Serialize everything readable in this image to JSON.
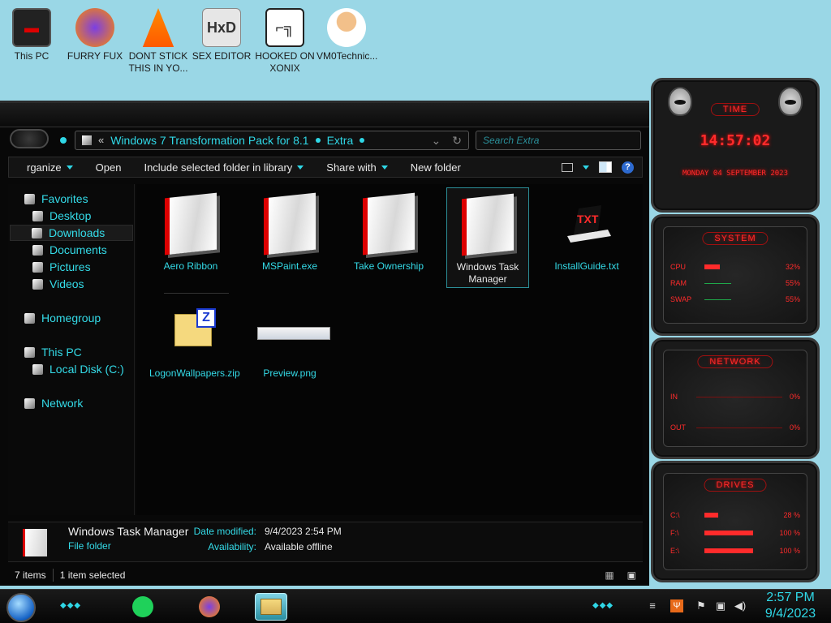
{
  "desktop": {
    "icons": [
      {
        "label": "This PC"
      },
      {
        "label": "FURRY FUX"
      },
      {
        "label": "DONT STICK THIS IN YO..."
      },
      {
        "label": "SEX EDITOR"
      },
      {
        "label": "HOOKED ON XONIX"
      },
      {
        "label": "VM0Technic..."
      }
    ]
  },
  "explorer": {
    "address": {
      "prefix": "«",
      "crumbs": [
        "Windows 7 Transformation Pack for 8.1",
        "Extra"
      ]
    },
    "search_placeholder": "Search Extra",
    "commands": {
      "organize": "rganize",
      "open": "Open",
      "include": "Include selected folder in library",
      "share": "Share with",
      "new_folder": "New folder"
    },
    "nav": {
      "favorites": "Favorites",
      "desktop": "Desktop",
      "downloads": "Downloads",
      "documents": "Documents",
      "pictures": "Pictures",
      "videos": "Videos",
      "homegroup": "Homegroup",
      "this_pc": "This PC",
      "local_disk": "Local Disk (C:)",
      "network": "Network"
    },
    "files": [
      {
        "name": "Aero Ribbon"
      },
      {
        "name": "MSPaint.exe"
      },
      {
        "name": "Take Ownership"
      },
      {
        "name": "Windows Task Manager"
      },
      {
        "name": "InstallGuide.txt"
      },
      {
        "name": "LogonWallpapers.zip"
      },
      {
        "name": "Preview.png"
      }
    ],
    "details": {
      "name": "Windows Task Manager",
      "type": "File folder",
      "date_label": "Date modified:",
      "date_value": "9/4/2023 2:54 PM",
      "avail_label": "Availability:",
      "avail_value": "Available offline"
    },
    "status": {
      "items": "7 items",
      "selected": "1 item selected"
    }
  },
  "gadgets": {
    "time": {
      "title": "TIME",
      "clock": "14:57:02",
      "date": "MONDAY 04 SEPTEMBER 2023"
    },
    "system": {
      "title": "SYSTEM",
      "rows": [
        {
          "label": "CPU",
          "value": "32%",
          "level": 0.32
        },
        {
          "label": "RAM",
          "value": "55%",
          "level": 0.55
        },
        {
          "label": "SWAP",
          "value": "55%",
          "level": 0.55
        }
      ]
    },
    "network": {
      "title": "NETWORK",
      "in_label": "IN",
      "in_value": "0%",
      "out_label": "OUT",
      "out_value": "0%"
    },
    "drives": {
      "title": "DRIVES",
      "rows": [
        {
          "label": "C:\\",
          "value": "28 %",
          "level": 0.28
        },
        {
          "label": "F:\\",
          "value": "100 %",
          "level": 1.0
        },
        {
          "label": "E:\\",
          "value": "100 %",
          "level": 1.0
        }
      ]
    }
  },
  "taskbar": {
    "time": "2:57 PM",
    "date": "9/4/2023"
  },
  "colors": {
    "accent": "#2fd7e6",
    "gadget_red": "#ff2b2b",
    "desktop_bg": "#9ad7e6"
  }
}
